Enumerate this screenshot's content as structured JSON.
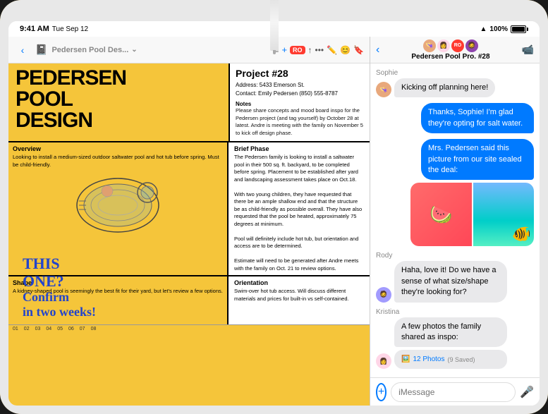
{
  "device": {
    "status_bar": {
      "time": "9:41 AM",
      "date": "Tue Sep 12",
      "battery": "100%",
      "battery_full": true
    }
  },
  "notes_panel": {
    "toolbar": {
      "back_label": "‹",
      "title": "Pedersen Pool Des...",
      "title_caret": "⌄",
      "list_icon": "≡",
      "add_icon": "+",
      "more_icon": "RO",
      "share_icon": "↑",
      "bookmark_icon": "🔖"
    },
    "document": {
      "main_title_line1": "PEDERSEN",
      "main_title_line2": "POOL",
      "main_title_line3": "DESIGN",
      "project_number": "Project #28",
      "address": "Address: 5433 Emerson St.",
      "contact": "Contact: Emily Pedersen (850) 555-8787",
      "notes_label": "Notes",
      "notes_text": "Please share concepts and mood board inspo for the Pedersen project (and tag yourself) by October 28 at latest. Andre is meeting with the family on November 5 to kick off design phase.",
      "overview_label": "Overview",
      "overview_text": "Looking to install a medium-sized outdoor saltwater pool and hot tub before spring. Must be child-friendly.",
      "brief_phase_label": "Brief Phase",
      "brief_phase_text": "The Pedersen family is looking to install a saltwater pool in their 500 sq. ft. backyard, to be completed before spring. Placement to be established after yard and landscaping assessment takes place on Oct.18.\n\nWith two young children, they have requested that there be an ample shallow end and that the structure be as child-friendly as possible overall. They have also requested that the pool be heated, approximately 75 degrees at minimum.\n\nPool will definitely include hot tub, but orientation and access are to be determined.\n\nEstimate will need to be generated after Andre meets with the family on Oct. 21 to review options.",
      "shape_label": "Shape",
      "shape_text": "A kidney-shaped pool is seemingly the best fit for their yard, but let's review a few options.",
      "orientation_label": "Orientation",
      "orientation_text": "Swim-over hot tub access. Will discuss different materials and prices for built-in vs self-contained.",
      "ruler_ticks": [
        "01",
        "02",
        "03",
        "04",
        "05",
        "06",
        "07",
        "08"
      ],
      "handwriting": "THIS\nONE?\nConfirm\nin two weeks!"
    }
  },
  "messages_panel": {
    "toolbar": {
      "back_icon": "‹",
      "title": "Pedersen Pool Pro. #28",
      "video_icon": "📹"
    },
    "messages": [
      {
        "sender": "Sophie",
        "text": "Kicking off planning here!",
        "type": "incoming",
        "avatar_emoji": "👒"
      },
      {
        "sender": "",
        "text": "Thanks, Sophie! I'm glad they're opting for salt water.",
        "type": "outgoing"
      },
      {
        "sender": "",
        "text": "Mrs. Pedersen said this picture from our site sealed the deal:",
        "type": "outgoing",
        "has_image": true
      },
      {
        "sender": "Rody",
        "text": "Haha, love it! Do we have a sense of what size/shape they're looking for?",
        "type": "incoming",
        "avatar_emoji": "🧔"
      },
      {
        "sender": "Kristina",
        "text": "A few photos the family shared as inspo:",
        "type": "incoming",
        "avatar_emoji": "👩",
        "photos_count": "12 Photos",
        "photos_saved": "9 Saved"
      }
    ],
    "input": {
      "placeholder": "iMessage"
    }
  }
}
